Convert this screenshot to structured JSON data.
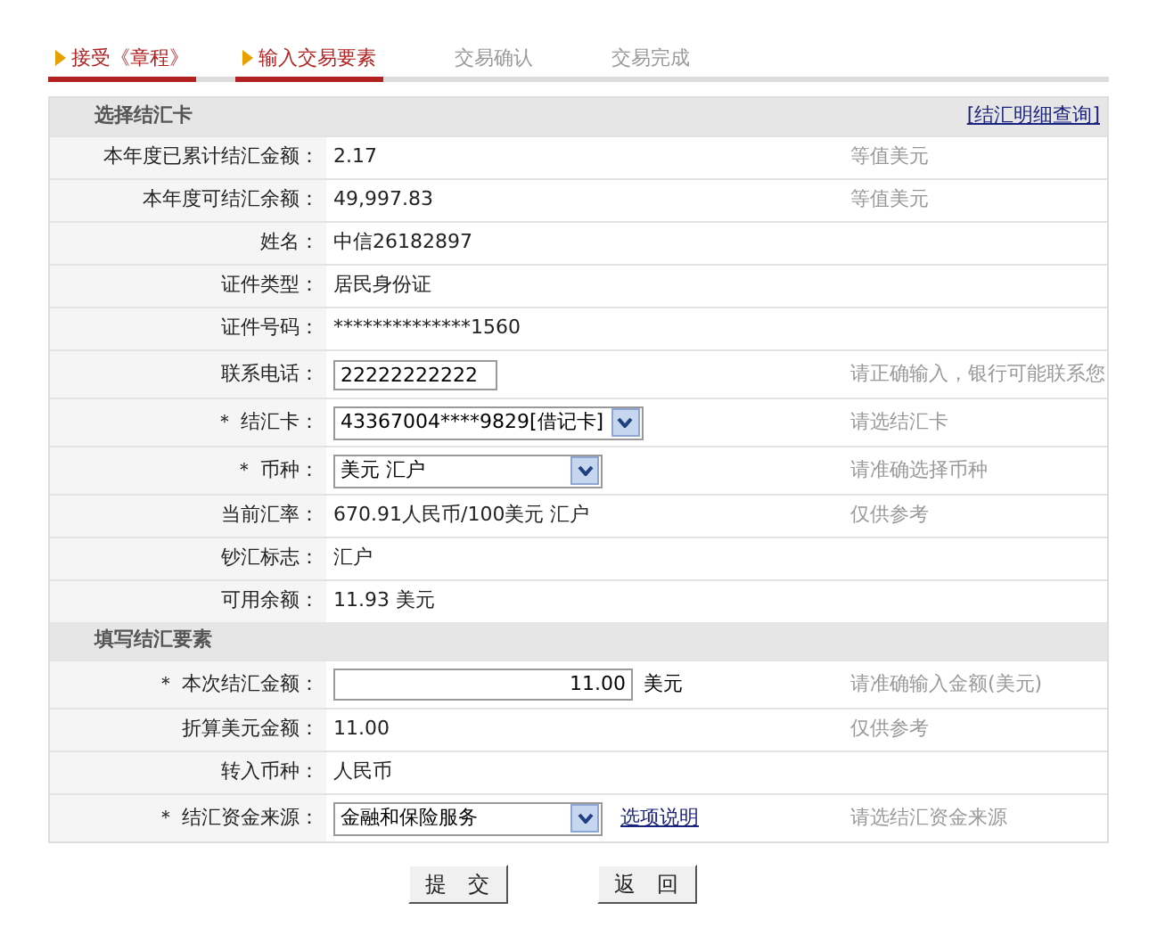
{
  "steps": [
    {
      "label": "接受《章程》",
      "active": true
    },
    {
      "label": "输入交易要素",
      "active": true
    },
    {
      "label": "交易确认",
      "active": false
    },
    {
      "label": "交易完成",
      "active": false
    }
  ],
  "sections": [
    {
      "title": "选择结汇卡",
      "link": "[结汇明细查询]",
      "rows": [
        {
          "kind": "text",
          "label": "本年度已累计结汇金额：",
          "value": "2.17",
          "hint": "等值美元"
        },
        {
          "kind": "text",
          "label": "本年度可结汇余额：",
          "value": "49,997.83",
          "hint": "等值美元"
        },
        {
          "kind": "text",
          "label": "姓名：",
          "value": "中信26182897"
        },
        {
          "kind": "text",
          "label": "证件类型：",
          "value": "居民身份证"
        },
        {
          "kind": "text",
          "label": "证件号码：",
          "value": "**************1560"
        },
        {
          "kind": "input",
          "label": "联系电话：",
          "value": "22222222222",
          "hint": "请正确输入，银行可能联系您"
        },
        {
          "kind": "select",
          "label": "＊ 结汇卡：",
          "value": "43367004****9829[借记卡]",
          "hint": "请选结汇卡"
        },
        {
          "kind": "select",
          "label": "＊ 币种：",
          "value": "美元 汇户",
          "hint": "请准确选择币种"
        },
        {
          "kind": "text",
          "label": "当前汇率：",
          "value": "670.91人民币/100美元 汇户",
          "hint": "仅供参考"
        },
        {
          "kind": "text",
          "label": "钞汇标志：",
          "value": "汇户"
        },
        {
          "kind": "text",
          "label": "可用余额：",
          "value": "11.93 美元"
        }
      ]
    },
    {
      "title": "填写结汇要素",
      "rows": [
        {
          "kind": "amount",
          "label": "＊ 本次结汇金额：",
          "value": "11.00",
          "unit": "美元",
          "hint": "请准确输入金额(美元)"
        },
        {
          "kind": "text",
          "label": "折算美元金额：",
          "value": "11.00",
          "hint": "仅供参考"
        },
        {
          "kind": "text",
          "label": "转入币种：",
          "value": "人民币"
        },
        {
          "kind": "select",
          "label": "＊ 结汇资金来源：",
          "value": "金融和保险服务",
          "link": "选项说明",
          "hint": "请选结汇资金来源"
        }
      ]
    }
  ],
  "buttons": [
    "提　交",
    "返　回"
  ]
}
